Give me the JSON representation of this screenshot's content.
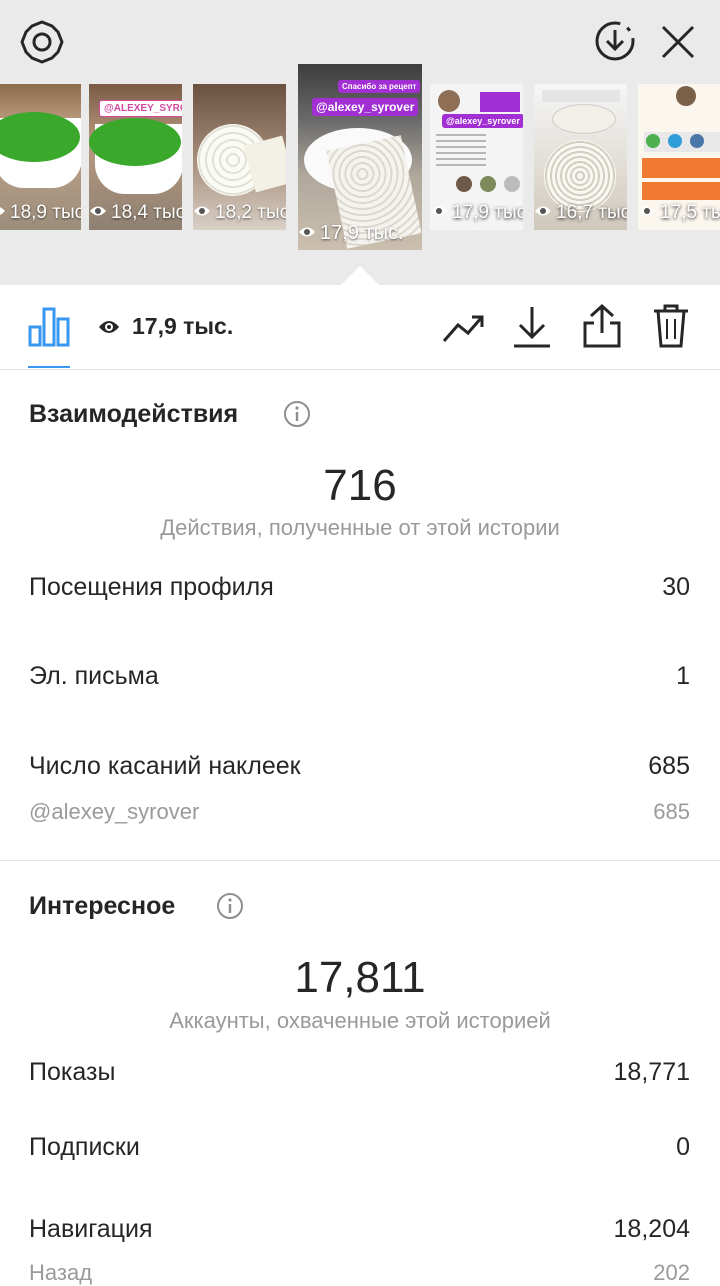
{
  "stories": [
    {
      "views": "18,9 тыс."
    },
    {
      "views": "18,4 тыс.",
      "tag": "@ALEXEY_SYROVER"
    },
    {
      "views": "18,2 тыс."
    },
    {
      "views": "17,9 тыс.",
      "tag": "@alexey_syrover",
      "caption": "Спасибо за рецепт",
      "selected": true
    },
    {
      "views": "17,9 тыс.",
      "tag": "@alexey_syrover"
    },
    {
      "views": "16,7 тыс."
    },
    {
      "views": "17,5 тыс."
    }
  ],
  "toolbar": {
    "views": "17,9 тыс."
  },
  "interactions": {
    "title": "Взаимодействия",
    "total": "716",
    "caption": "Действия, полученные от этой истории",
    "rows": [
      {
        "label": "Посещения профиля",
        "value": "30"
      },
      {
        "label": "Эл. письма",
        "value": "1"
      },
      {
        "label": "Число касаний наклеек",
        "value": "685"
      }
    ],
    "sub": {
      "label": "@alexey_syrover",
      "value": "685"
    }
  },
  "discovery": {
    "title": "Интересное",
    "total": "17,811",
    "caption": "Аккаунты, охваченные этой историей",
    "rows": [
      {
        "label": "Показы",
        "value": "18,771"
      },
      {
        "label": "Подписки",
        "value": "0"
      },
      {
        "label": "Навигация",
        "value": "18,204"
      }
    ],
    "sub": {
      "label": "Назад",
      "value": "202"
    }
  },
  "colors": {
    "accent": "#3897f0",
    "tag": "#a12fd4",
    "lid": "#3aa82a"
  }
}
